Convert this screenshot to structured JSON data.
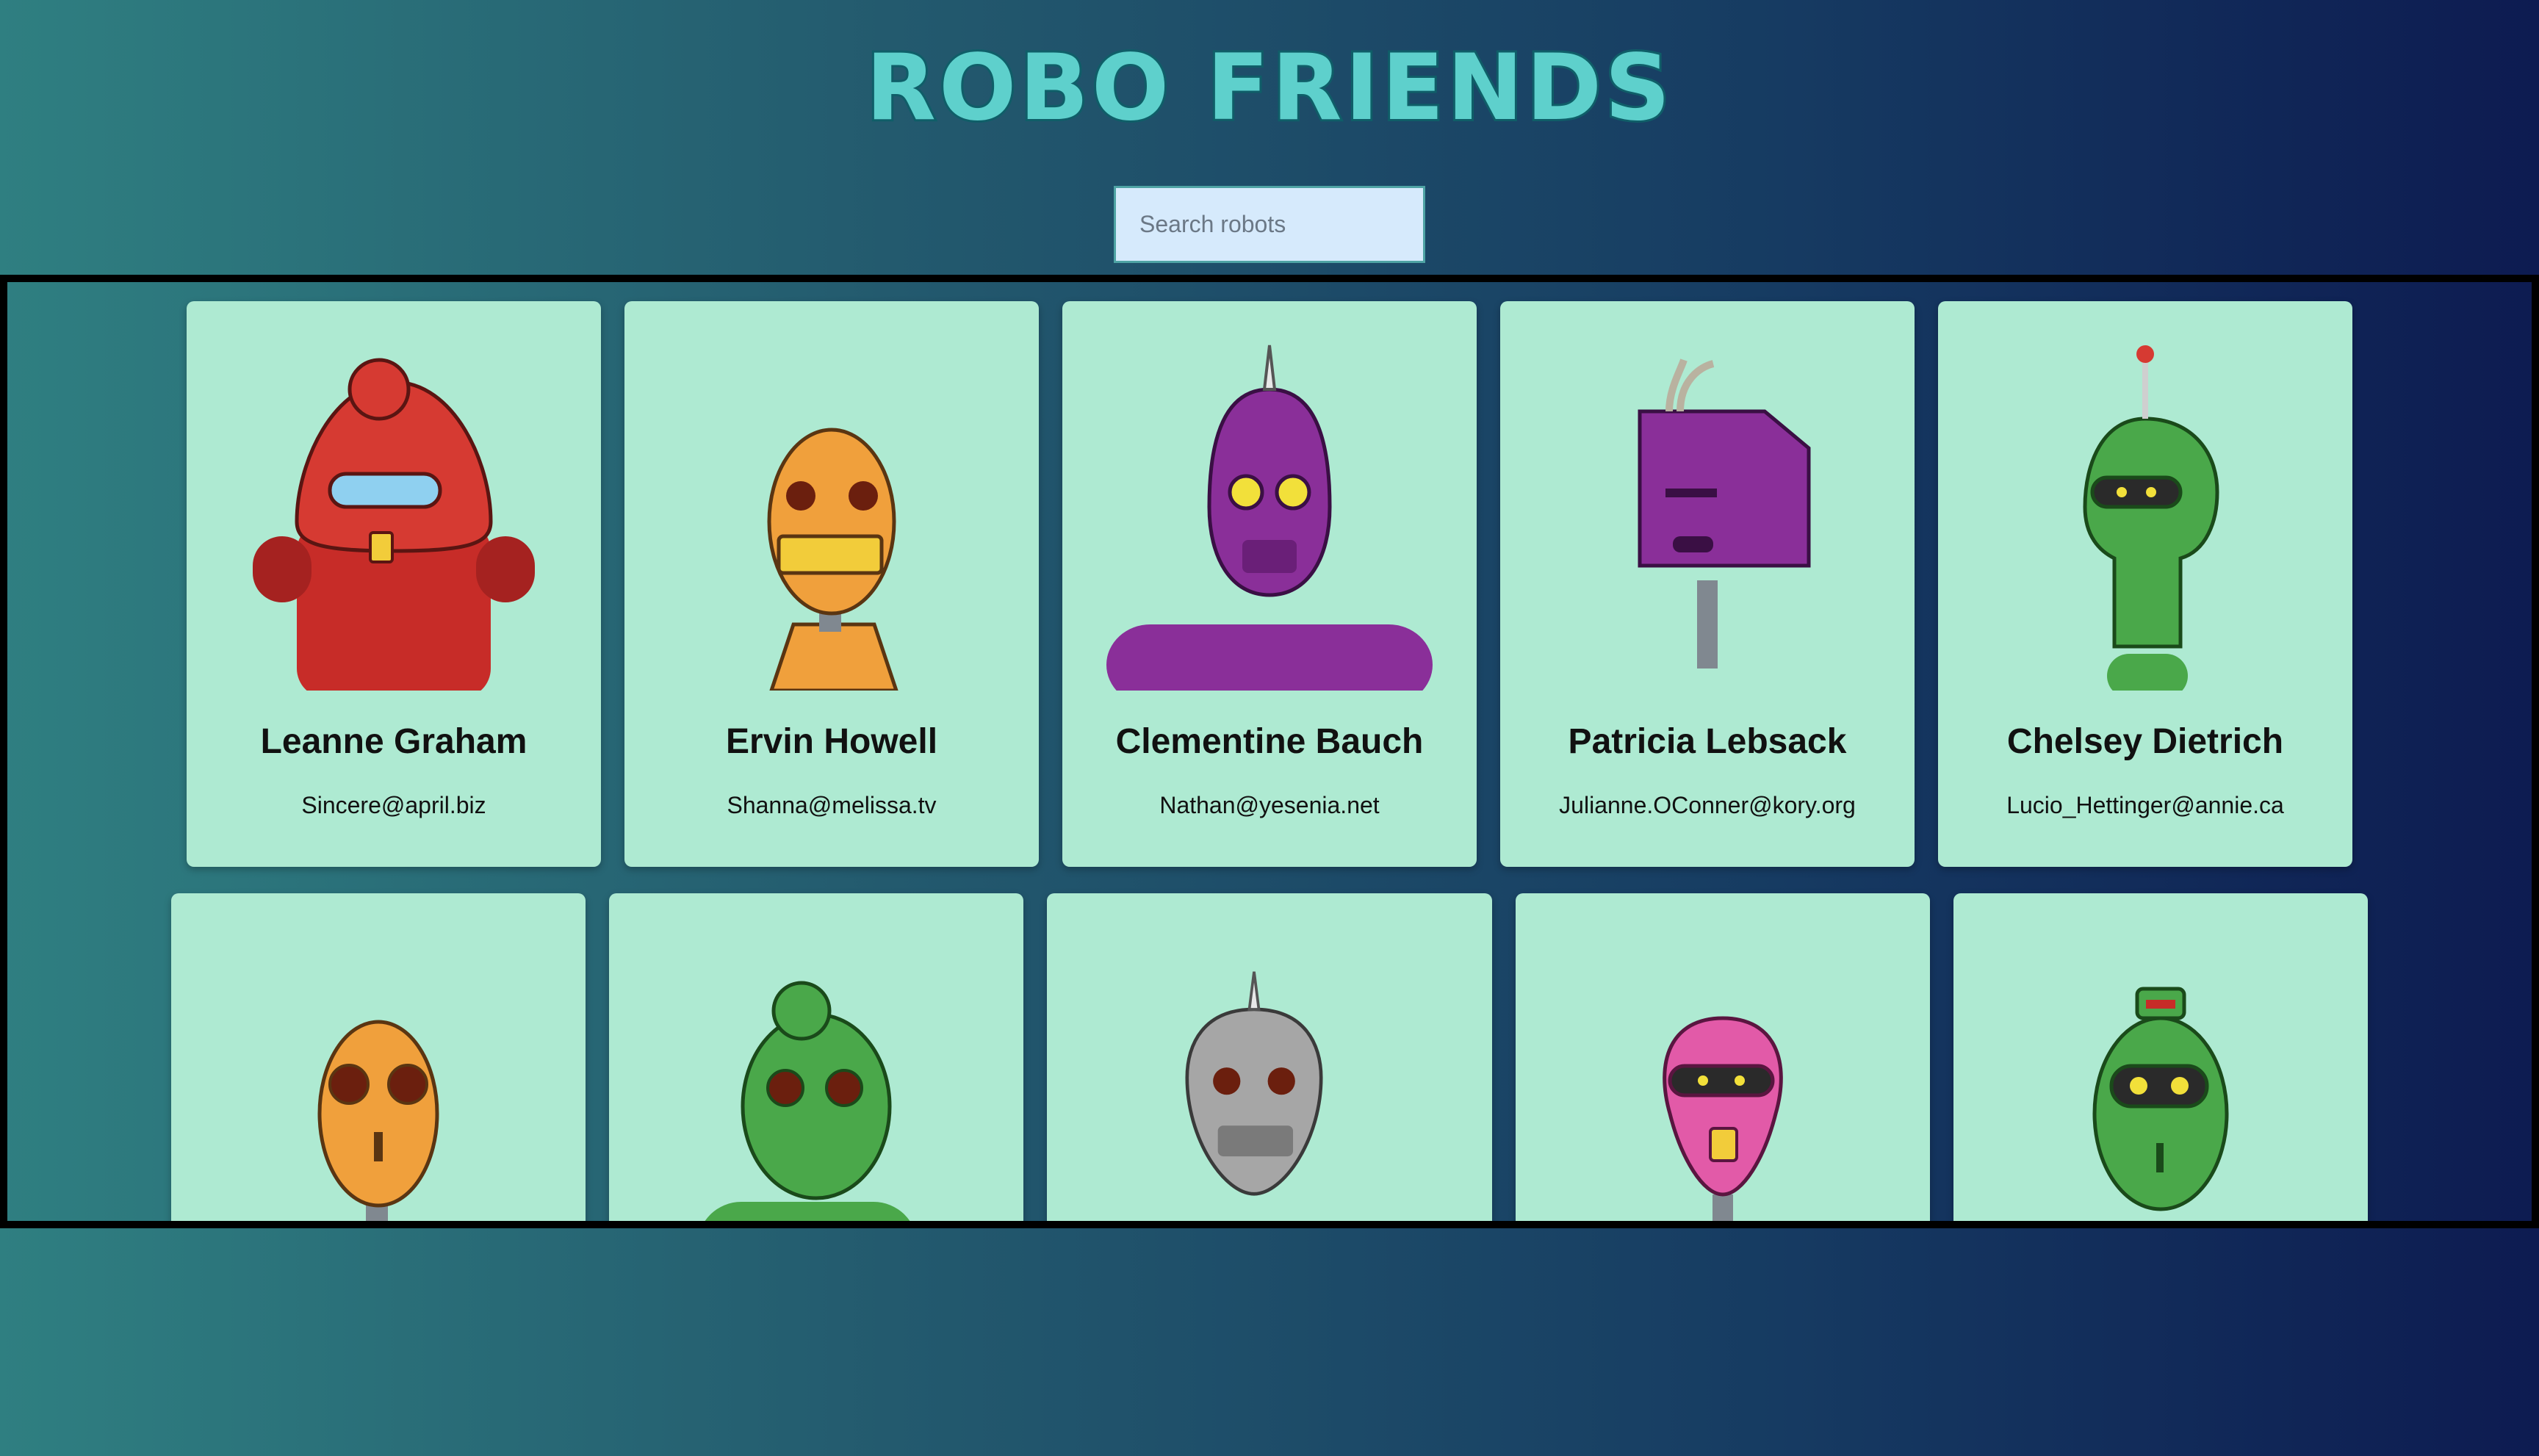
{
  "app": {
    "title": "ROBO FRIENDS"
  },
  "search": {
    "placeholder": "Search robots",
    "value": ""
  },
  "robots": [
    {
      "name": "Leanne Graham",
      "email": "Sincere@april.biz",
      "color": "#d63a32"
    },
    {
      "name": "Ervin Howell",
      "email": "Shanna@melissa.tv",
      "color": "#f0a03c"
    },
    {
      "name": "Clementine Bauch",
      "email": "Nathan@yesenia.net",
      "color": "#8a2f99"
    },
    {
      "name": "Patricia Lebsack",
      "email": "Julianne.OConner@kory.org",
      "color": "#8a2f99"
    },
    {
      "name": "Chelsey Dietrich",
      "email": "Lucio_Hettinger@annie.ca",
      "color": "#4aa84a"
    },
    {
      "name": "",
      "email": "",
      "color": "#f0a03c"
    },
    {
      "name": "",
      "email": "",
      "color": "#4aa84a"
    },
    {
      "name": "",
      "email": "",
      "color": "#a6a6a6"
    },
    {
      "name": "",
      "email": "",
      "color": "#e25aa8"
    },
    {
      "name": "",
      "email": "",
      "color": "#4aa84a"
    }
  ]
}
